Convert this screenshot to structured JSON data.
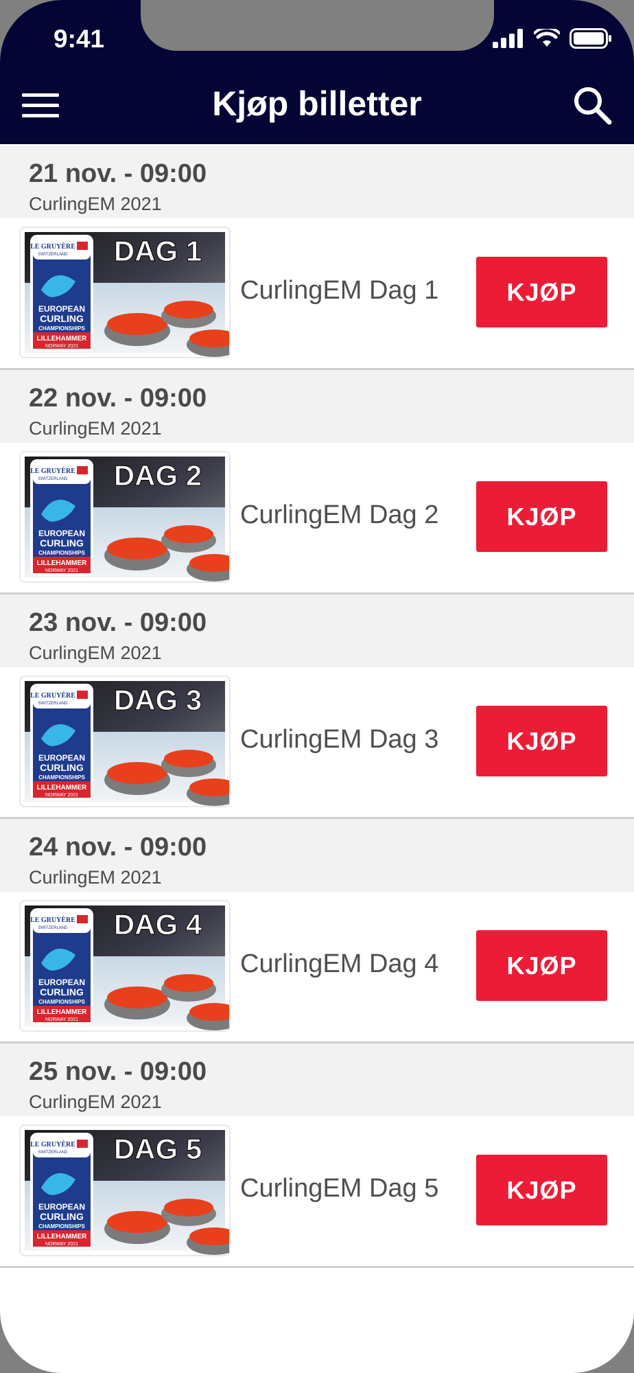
{
  "status": {
    "time": "9:41"
  },
  "header": {
    "title": "Kjøp billetter"
  },
  "events": [
    {
      "date": "21 nov. - 09:00",
      "subtitle": "CurlingEM 2021",
      "name": "CurlingEM Dag 1",
      "badge": "DAG 1",
      "button": "KJØP"
    },
    {
      "date": "22 nov. - 09:00",
      "subtitle": "CurlingEM 2021",
      "name": "CurlingEM Dag 2",
      "badge": "DAG 2",
      "button": "KJØP"
    },
    {
      "date": "23 nov. - 09:00",
      "subtitle": "CurlingEM 2021",
      "name": "CurlingEM Dag 3",
      "badge": "DAG 3",
      "button": "KJØP"
    },
    {
      "date": "24 nov. - 09:00",
      "subtitle": "CurlingEM 2021",
      "name": "CurlingEM Dag 4",
      "badge": "DAG 4",
      "button": "KJØP"
    },
    {
      "date": "25 nov. - 09:00",
      "subtitle": "CurlingEM 2021",
      "name": "CurlingEM Dag 5",
      "badge": "DAG 5",
      "button": "KJØP"
    }
  ],
  "thumbnail_logo": {
    "brand": "LE GRUYÈRE",
    "brand_sub": "SWITZERLAND",
    "line1": "EUROPEAN",
    "line2": "CURLING",
    "line3": "CHAMPIONSHIPS",
    "line4": "LILLEHAMMER",
    "line5": "NORWAY 2021"
  },
  "colors": {
    "header_bg": "#050535",
    "accent": "#ed1c36",
    "section_bg": "#f2f2f2"
  },
  "icons": {
    "menu": "hamburger-icon",
    "search": "search-icon",
    "signal": "signal-icon",
    "wifi": "wifi-icon",
    "battery": "battery-icon"
  }
}
